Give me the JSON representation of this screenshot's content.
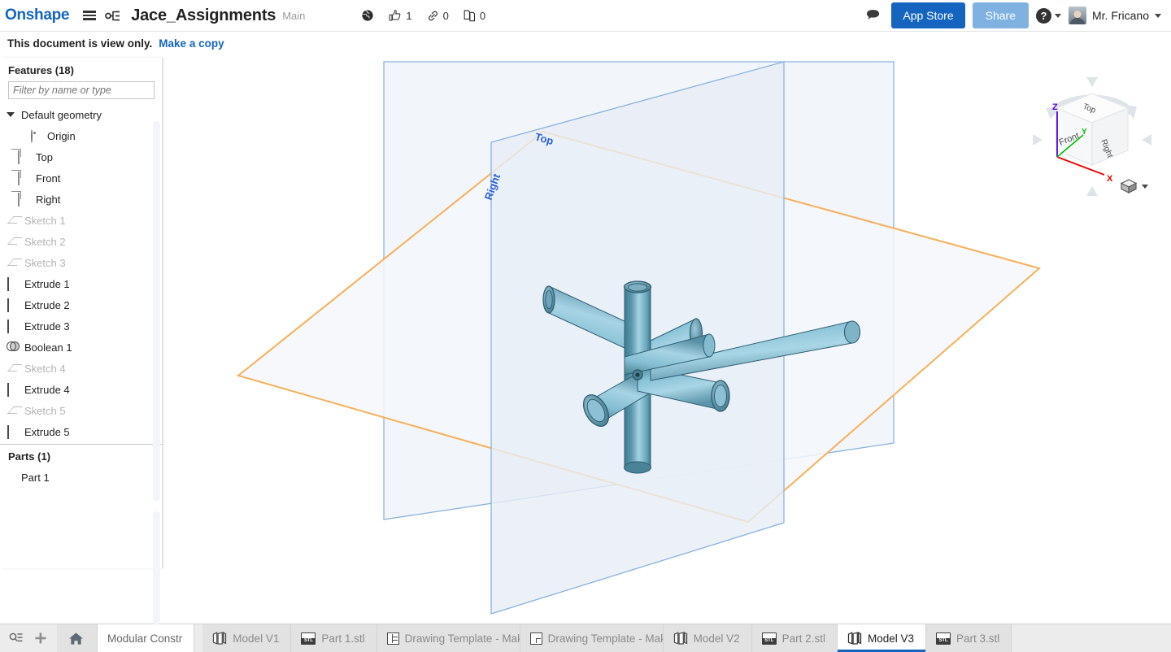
{
  "app": {
    "logo": "Onshape",
    "document_title": "Jace_Assignments",
    "branch": "Main"
  },
  "header": {
    "menu_icon": "hamburger-menu-icon",
    "tree_icon": "version-tree-icon",
    "public_icon": "globe-icon",
    "stats": [
      {
        "icon": "thumbs-up-icon",
        "value": "1"
      },
      {
        "icon": "link-icon",
        "value": "0"
      },
      {
        "icon": "copy-icon",
        "value": "0"
      }
    ],
    "comment_icon": "comment-icon",
    "app_store_label": "App Store",
    "share_label": "Share",
    "help_label": "?",
    "user_name": "Mr. Fricano"
  },
  "banner": {
    "message": "This document is view only.",
    "link_label": "Make a copy"
  },
  "feature_panel": {
    "title": "Features (18)",
    "filter_placeholder": "Filter by name or type",
    "groups": [
      {
        "label": "Default geometry",
        "icon": "chevron-down-icon",
        "children": [
          {
            "label": "Origin",
            "icon": "origin-icon",
            "muted": false
          },
          {
            "label": "Top",
            "icon": "plane-icon",
            "muted": false
          },
          {
            "label": "Front",
            "icon": "plane-icon",
            "muted": false
          },
          {
            "label": "Right",
            "icon": "plane-icon",
            "muted": false
          }
        ]
      }
    ],
    "features": [
      {
        "label": "Sketch 1",
        "icon": "sketch-icon",
        "muted": true
      },
      {
        "label": "Sketch 2",
        "icon": "sketch-icon",
        "muted": true
      },
      {
        "label": "Sketch 3",
        "icon": "sketch-icon",
        "muted": true
      },
      {
        "label": "Extrude 1",
        "icon": "extrude-icon",
        "muted": false
      },
      {
        "label": "Extrude 2",
        "icon": "extrude-icon",
        "muted": false
      },
      {
        "label": "Extrude 3",
        "icon": "extrude-icon",
        "muted": false
      },
      {
        "label": "Boolean 1",
        "icon": "boolean-icon",
        "muted": false
      },
      {
        "label": "Sketch 4",
        "icon": "sketch-icon",
        "muted": true
      },
      {
        "label": "Extrude 4",
        "icon": "extrude-icon",
        "muted": false
      },
      {
        "label": "Sketch 5",
        "icon": "sketch-icon",
        "muted": true
      },
      {
        "label": "Extrude 5",
        "icon": "extrude-icon",
        "muted": false
      }
    ],
    "parts_title": "Parts (1)",
    "parts": [
      {
        "label": "Part 1"
      }
    ]
  },
  "viewport": {
    "plane_labels": {
      "top": "Top",
      "right": "Right"
    },
    "colors": {
      "background": "#ffffff",
      "plane_fill": "#eef3f8",
      "plane_stroke": "#8ab2dd",
      "top_plane_stroke": "#f5b860",
      "part_light": "#9ed0e3",
      "part_dark": "#3f7f96"
    },
    "viewcube": {
      "face_top": "Top",
      "face_front": "Front",
      "face_right": "Right",
      "axis_x": "X",
      "axis_y": "Y",
      "axis_z": "Z",
      "axis_x_color": "#ee0000",
      "axis_y_color": "#00bb00",
      "axis_z_color": "#5500dd",
      "view_dropdown_icon": "view-cube-icon"
    }
  },
  "tabbar": {
    "search_icon": "search-tabs-icon",
    "add_icon": "add-tab-icon",
    "home_icon": "home-icon",
    "breadcrumb": "Modular Constr",
    "tabs": [
      {
        "label": "Model V1",
        "icon": "part-studio-icon",
        "active": false
      },
      {
        "label": "Part 1.stl",
        "icon": "stl-icon",
        "active": false
      },
      {
        "label": "Drawing Template - Mak...",
        "icon": "drawing-template-icon",
        "active": false
      },
      {
        "label": "Drawing Template - Mak...",
        "icon": "drawing-icon",
        "active": false
      },
      {
        "label": "Model V2",
        "icon": "part-studio-icon",
        "active": false
      },
      {
        "label": "Part 2.stl",
        "icon": "stl-icon",
        "active": false
      },
      {
        "label": "Model V3",
        "icon": "part-studio-icon",
        "active": true
      },
      {
        "label": "Part 3.stl",
        "icon": "stl-icon",
        "active": false
      }
    ]
  }
}
